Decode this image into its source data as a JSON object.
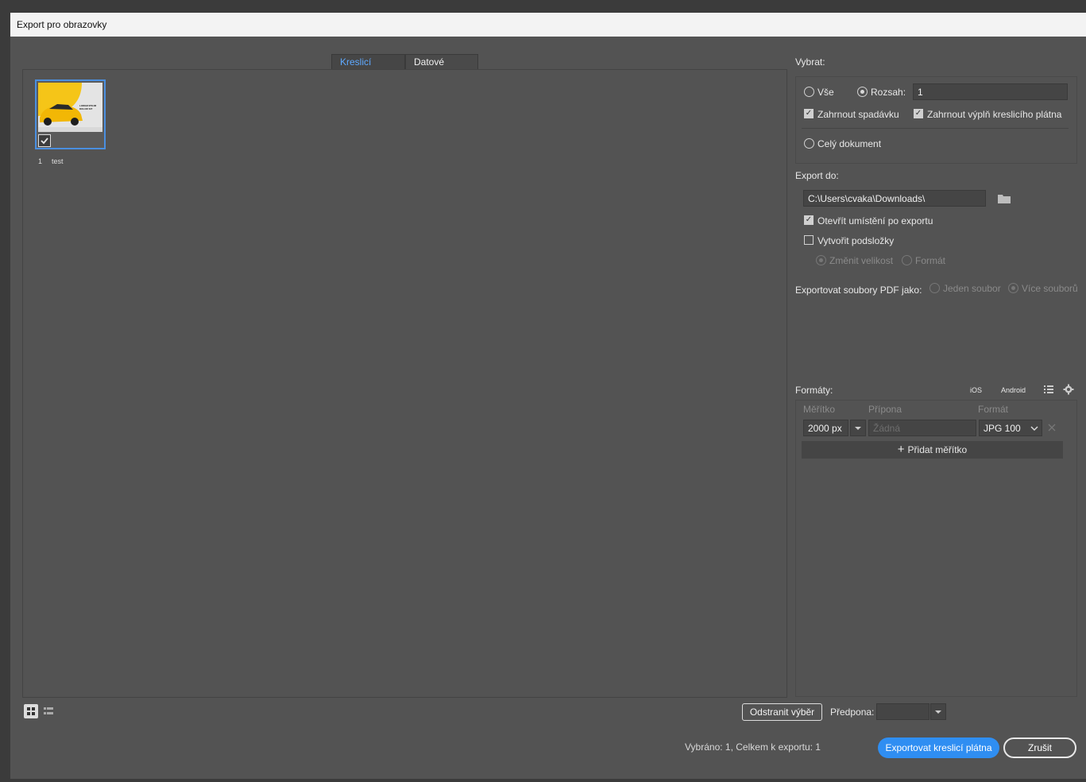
{
  "window": {
    "title": "Export pro obrazovky"
  },
  "tabs": [
    {
      "label": "Kreslicí plátna",
      "active": true
    },
    {
      "label": "Datové zdroje",
      "active": false
    }
  ],
  "artboards": [
    {
      "number": "1",
      "name": "test",
      "selected": true,
      "thumb_text": "LOREM IPSUM DOLOR SIT"
    }
  ],
  "select": {
    "heading": "Vybrat:",
    "all_label": "Vše",
    "range_label": "Rozsah:",
    "range_value": "1",
    "include_bleed_label": "Zahrnout spadávku",
    "include_bleed": true,
    "include_fill_label": "Zahrnout výplň kreslicího plátna",
    "include_fill": true,
    "whole_doc_label": "Celý dokument"
  },
  "export_to": {
    "heading": "Export do:",
    "path": "C:\\Users\\cvaka\\Downloads\\",
    "open_after_label": "Otevřít umístění po exportu",
    "open_after": true,
    "subfolders_label": "Vytvořit podsložky",
    "subfolders": false,
    "resize_label": "Změnit velikost",
    "format_label": "Formát"
  },
  "pdf": {
    "label": "Exportovat soubory PDF jako:",
    "single_label": "Jeden soubor",
    "multi_label": "Více souborů"
  },
  "formats": {
    "heading": "Formáty:",
    "ios_label": "iOS",
    "android_label": "Android",
    "col_scale": "Měřítko",
    "col_suffix": "Přípona",
    "col_format": "Formát",
    "rows": [
      {
        "scale": "2000 px",
        "suffix_placeholder": "Žádná",
        "format": "JPG 100"
      }
    ],
    "add_scale_label": "Přidat měřítko"
  },
  "bottom": {
    "clear_selection_label": "Odstranit výběr",
    "prefix_label": "Předpona:",
    "prefix_value": "",
    "status": "Vybráno: 1, Celkem k exportu: 1",
    "export_button": "Exportovat kreslicí plátna",
    "cancel_button": "Zrušit"
  },
  "colors": {
    "accent": "#2f8ef2",
    "tab_active": "#5ea9ff",
    "panel_bg": "#535353",
    "thumb_yellow": "#f5c518"
  }
}
